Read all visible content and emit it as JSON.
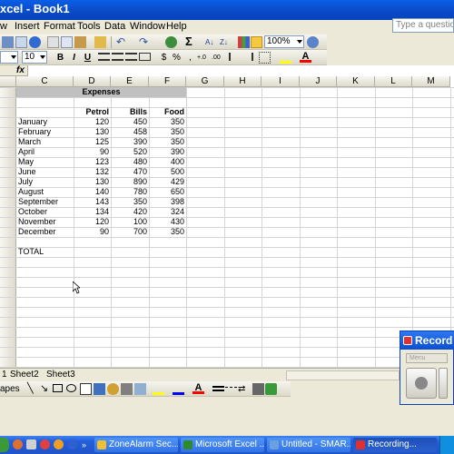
{
  "window": {
    "title": "xcel - Book1"
  },
  "menu": [
    "w",
    "Insert",
    "Format",
    "Tools",
    "Data",
    "Window",
    "Help"
  ],
  "help_placeholder": "Type a question f",
  "toolbar": {
    "zoom": "100%",
    "font_size": "10"
  },
  "formula": {
    "fx": "fx"
  },
  "columns": [
    "C",
    "D",
    "E",
    "F",
    "G",
    "H",
    "I",
    "J",
    "K",
    "L",
    "M"
  ],
  "sheet": {
    "title": "Expenses",
    "headers": [
      "Petrol",
      "Bills",
      "Food"
    ],
    "rows": [
      {
        "month": "January",
        "petrol": "120",
        "bills": "450",
        "food": "350"
      },
      {
        "month": "February",
        "petrol": "130",
        "bills": "458",
        "food": "350"
      },
      {
        "month": "March",
        "petrol": "125",
        "bills": "390",
        "food": "350"
      },
      {
        "month": "April",
        "petrol": "90",
        "bills": "520",
        "food": "390"
      },
      {
        "month": "May",
        "petrol": "123",
        "bills": "480",
        "food": "400"
      },
      {
        "month": "June",
        "petrol": "132",
        "bills": "470",
        "food": "500"
      },
      {
        "month": "July",
        "petrol": "130",
        "bills": "890",
        "food": "429"
      },
      {
        "month": "August",
        "petrol": "140",
        "bills": "780",
        "food": "650"
      },
      {
        "month": "September",
        "petrol": "143",
        "bills": "350",
        "food": "398"
      },
      {
        "month": "October",
        "petrol": "134",
        "bills": "420",
        "food": "324"
      },
      {
        "month": "November",
        "petrol": "120",
        "bills": "100",
        "food": "430"
      },
      {
        "month": "December",
        "petrol": "90",
        "bills": "700",
        "food": "350"
      }
    ],
    "total_label": "TOTAL"
  },
  "tabs": [
    "1",
    "Sheet2",
    "Sheet3"
  ],
  "drawbar": {
    "autoshapes": "apes"
  },
  "recording": {
    "title": "Record",
    "menu_label": "Menu"
  },
  "taskbar": {
    "items": [
      "ZoneAlarm Sec...",
      "Microsoft Excel ...",
      "Untitled - SMAR...",
      "Recording..."
    ]
  },
  "colors": {
    "titlebar": "#0a4fd0",
    "taskbar": "#245edb",
    "header_gray": "#c0c0c0"
  }
}
